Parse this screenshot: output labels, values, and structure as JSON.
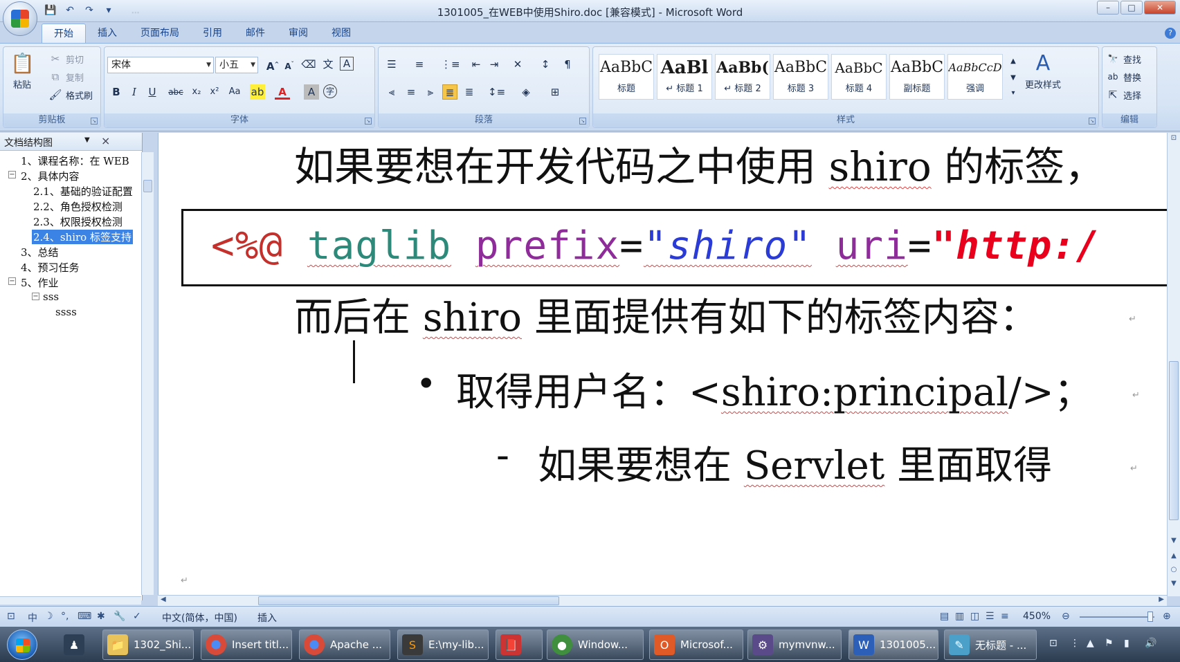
{
  "window": {
    "title": "1301005_在WEB中使用Shiro.doc [兼容模式] - Microsoft Word",
    "qat_path": "...",
    "controls": [
      "–",
      "□",
      "✕"
    ]
  },
  "ribbon": {
    "tabs": [
      "开始",
      "插入",
      "页面布局",
      "引用",
      "邮件",
      "审阅",
      "视图"
    ],
    "active_tab": "开始",
    "clipboard": {
      "label": "剪贴板",
      "paste": "粘贴",
      "cut": "剪切",
      "copy": "复制",
      "format_painter": "格式刷"
    },
    "font": {
      "label": "字体",
      "font_name": "宋体",
      "font_size": "小五",
      "grow": "A",
      "shrink": "A",
      "bold": "B",
      "italic": "I",
      "underline": "U",
      "strike": "abc",
      "subscript": "x₂",
      "superscript": "x²",
      "case": "Aa"
    },
    "paragraph": {
      "label": "段落"
    },
    "styles": {
      "label": "样式",
      "items": [
        {
          "sample": "AaBbC",
          "name": "标题"
        },
        {
          "sample": "AaBl",
          "name": "↵ 标题 1"
        },
        {
          "sample": "AaBb(",
          "name": "↵ 标题 2"
        },
        {
          "sample": "AaBbC",
          "name": "标题 3"
        },
        {
          "sample": "AaBbC",
          "name": "标题 4"
        },
        {
          "sample": "AaBbC",
          "name": "副标题"
        },
        {
          "sample": "AaBbCcD",
          "name": "强调"
        }
      ],
      "change_styles": "更改样式"
    },
    "editing": {
      "label": "编辑",
      "find": "查找",
      "replace": "替换",
      "select": "选择"
    }
  },
  "docmap": {
    "title": "文档结构图",
    "close": "×",
    "items": [
      {
        "text": "1、课程名称：在 WEB",
        "toggle": "",
        "selected": false
      },
      {
        "text": "2、具体内容",
        "toggle": "−",
        "selected": false
      },
      {
        "text": "2.1、基础的验证配置",
        "toggle": "",
        "selected": false
      },
      {
        "text": "2.2、角色授权检测",
        "toggle": "",
        "selected": false
      },
      {
        "text": "2.3、权限授权检测",
        "toggle": "",
        "selected": false
      },
      {
        "text": "2.4、shiro 标签支持",
        "toggle": "",
        "selected": true
      },
      {
        "text": "3、总结",
        "toggle": "",
        "selected": false
      },
      {
        "text": "4、预习任务",
        "toggle": "",
        "selected": false
      },
      {
        "text": "5、作业",
        "toggle": "−",
        "selected": false
      },
      {
        "text": "sss",
        "toggle": "−",
        "selected": false
      },
      {
        "text": "ssss",
        "toggle": "",
        "selected": false
      }
    ]
  },
  "document": {
    "line1_pre": "如果要想在开发代码之中使用 ",
    "line1_word": "shiro",
    "line1_post": " 的标签，",
    "code": {
      "open": "<%@",
      "taglib": "taglib",
      "prefix_attr": "prefix",
      "eq": "=",
      "prefix_val": "\"shiro\"",
      "uri_attr": "uri",
      "uri_val": "\"http:/"
    },
    "line2_pre": "而后在 ",
    "line2_word": "shiro",
    "line2_post": " 里面提供有如下的标签内容：",
    "bullet": "•",
    "line3_pre": "取得用户名：<",
    "line3_tag": "shiro:principal",
    "line3_post": "/>；",
    "line4_dash": "-",
    "line4_pre": "如果要想在 ",
    "line4_word": "Servlet",
    "line4_post": " 里面取得"
  },
  "statusbar": {
    "language": "中文(简体，中国)",
    "mode": "插入",
    "zoom": "450%"
  },
  "taskbar": {
    "items": [
      {
        "label": "1302_Shi...",
        "icon": "folder-icon",
        "color": "#e8c25a"
      },
      {
        "label": "Insert titl...",
        "icon": "chrome-icon",
        "color": "#d94a38"
      },
      {
        "label": "Apache ...",
        "icon": "chrome-icon",
        "color": "#d94a38"
      },
      {
        "label": "E:\\my-lib...",
        "icon": "sublime-icon",
        "color": "#3a3a3a"
      },
      {
        "label": "",
        "icon": "book-icon",
        "color": "#c33"
      },
      {
        "label": "Window...",
        "icon": "app-icon",
        "color": "#3f8f3f"
      },
      {
        "label": "Microsof...",
        "icon": "office-icon",
        "color": "#e05a28"
      },
      {
        "label": "mymvnw...",
        "icon": "eclipse-icon",
        "color": "#5a4a8a"
      },
      {
        "label": "1301005...",
        "icon": "word-icon",
        "color": "#2b5fb8"
      },
      {
        "label": "无标题 - ...",
        "icon": "paint-icon",
        "color": "#4aa0c8"
      }
    ]
  }
}
